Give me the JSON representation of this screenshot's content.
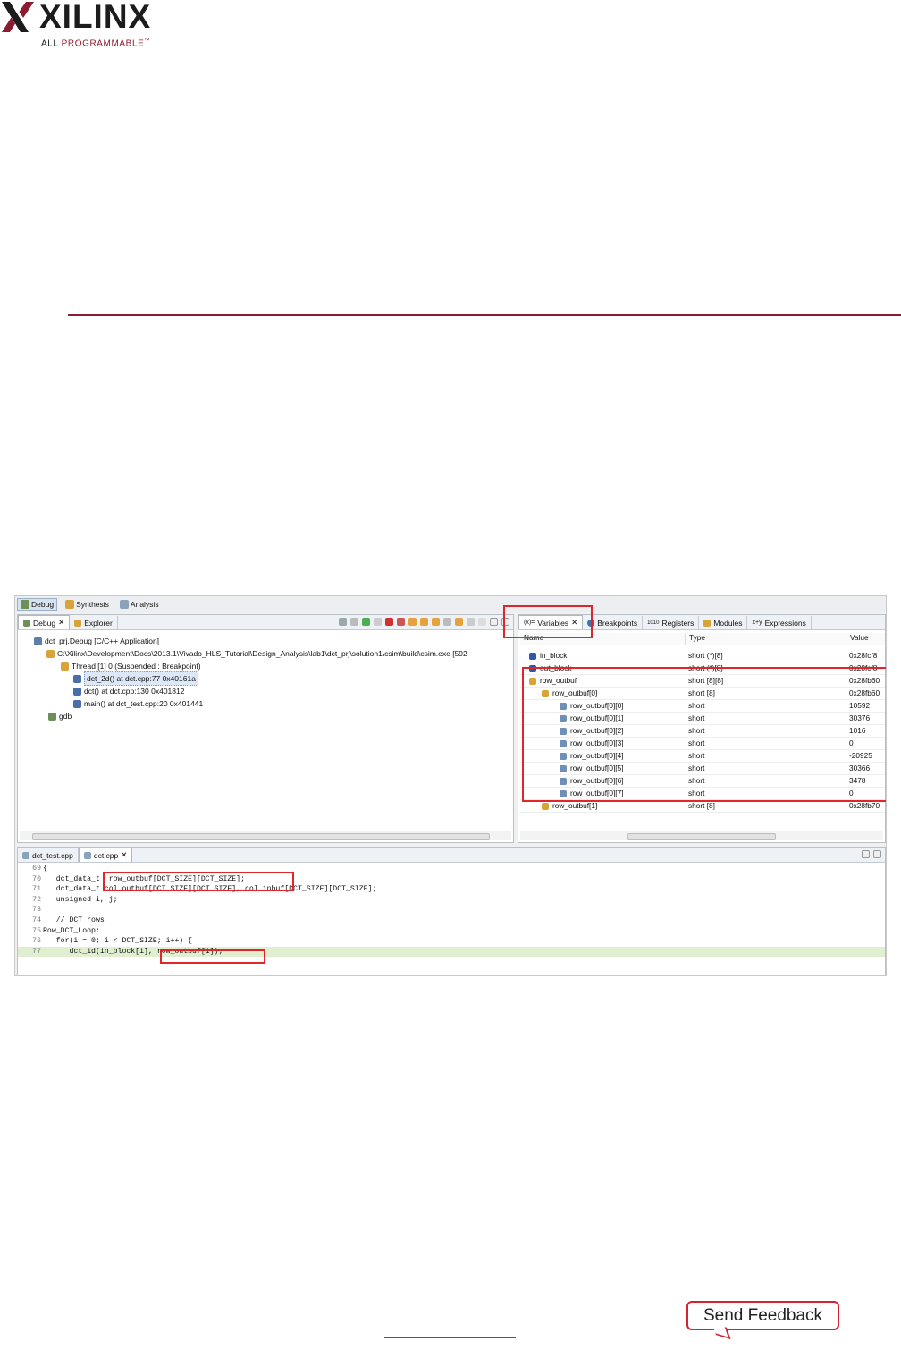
{
  "header": {
    "brand": "XILINX",
    "tagline_lead": "ALL",
    "tagline_rest": " PROGRAMMABLE",
    "tagline_tm": "™",
    "brand_color": "#8c1b2f"
  },
  "ide": {
    "perspectives": [
      "Debug",
      "Synthesis",
      "Analysis"
    ],
    "debug_view": {
      "tabs": [
        "Debug",
        "Explorer"
      ],
      "tree": [
        "dct_prj.Debug [C/C++ Application]",
        "C:\\Xilinx\\Development\\Docs\\2013.1\\Vivado_HLS_Tutorial\\Design_Analysis\\lab1\\dct_prj\\solution1\\csim\\build\\csim.exe [592",
        "Thread [1] 0 (Suspended : Breakpoint)",
        "dct_2d() at dct.cpp:77 0x40161a",
        "dct() at dct.cpp:130 0x401812",
        "main() at dct_test.cpp:20 0x401441",
        "gdb"
      ]
    },
    "variables_view": {
      "tabs": [
        "Variables",
        "Breakpoints",
        "Registers",
        "Modules",
        "Expressions"
      ],
      "columns": [
        "Name",
        "Type",
        "Value"
      ],
      "rows": [
        {
          "name": "in_block",
          "type": "short (*)[8]",
          "value": "0x28fcf8"
        },
        {
          "name": "out_block",
          "type": "short (*)[8]",
          "value": "0x28fcf8"
        },
        {
          "name": "row_outbuf",
          "type": "short [8][8]",
          "value": "0x28fb60"
        },
        {
          "name": "row_outbuf[0]",
          "type": "short [8]",
          "value": "0x28fb60"
        },
        {
          "name": "row_outbuf[0][0]",
          "type": "short",
          "value": "10592"
        },
        {
          "name": "row_outbuf[0][1]",
          "type": "short",
          "value": "30376"
        },
        {
          "name": "row_outbuf[0][2]",
          "type": "short",
          "value": "1016"
        },
        {
          "name": "row_outbuf[0][3]",
          "type": "short",
          "value": "0"
        },
        {
          "name": "row_outbuf[0][4]",
          "type": "short",
          "value": "-20925"
        },
        {
          "name": "row_outbuf[0][5]",
          "type": "short",
          "value": "30366"
        },
        {
          "name": "row_outbuf[0][6]",
          "type": "short",
          "value": "3478"
        },
        {
          "name": "row_outbuf[0][7]",
          "type": "short",
          "value": "0"
        },
        {
          "name": "row_outbuf[1]",
          "type": "short [8]",
          "value": "0x28fb70"
        }
      ]
    },
    "editor": {
      "tabs": [
        "dct_test.cpp",
        "dct.cpp"
      ],
      "lines": [
        {
          "n": "69",
          "code": "{"
        },
        {
          "n": "70",
          "code": "   dct_data_t  row_outbuf[DCT_SIZE][DCT_SIZE];"
        },
        {
          "n": "71",
          "code": "   dct_data_t col_outbuf[DCT_SIZE][DCT_SIZE], col_inbuf[DCT_SIZE][DCT_SIZE];"
        },
        {
          "n": "72",
          "code": "   unsigned i, j;"
        },
        {
          "n": "73",
          "code": ""
        },
        {
          "n": "74",
          "code": "   // DCT rows"
        },
        {
          "n": "75",
          "code": "Row_DCT_Loop:"
        },
        {
          "n": "76",
          "code": "   for(i = 0; i < DCT_SIZE; i++) {"
        },
        {
          "n": "77",
          "code": "      dct_1d(in_block[i], row_outbuf[i]);"
        }
      ]
    }
  },
  "footer": {
    "send_feedback": "Send Feedback"
  }
}
